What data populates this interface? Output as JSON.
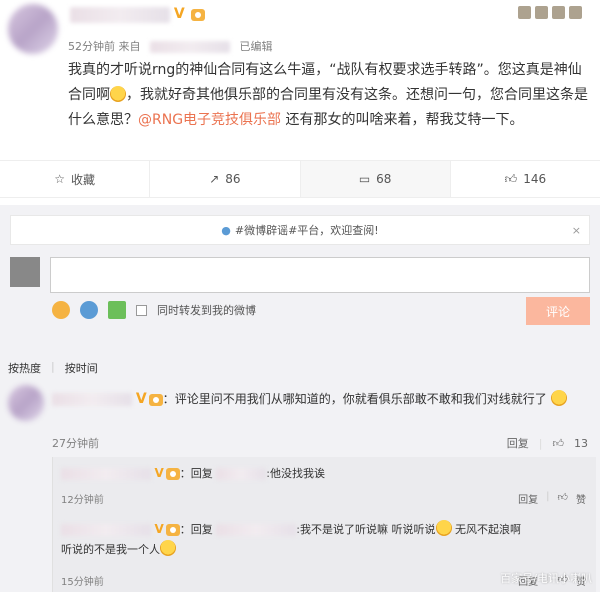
{
  "post": {
    "time": "52分钟前 来自",
    "edited": "已编辑",
    "text_part1": "我真的才听说rng的神仙合同有这么牛逼，“战队有权要求选手转路”。您这真是神仙合同啊",
    "text_part2": "，我就好奇其他俱乐部的合同里有没有这条。还想问一句，您合同里这条是什么意思？",
    "mention": "@RNG电子竞技俱乐部",
    "text_part3": " 还有那女的叫啥来着，帮我艾特一下。"
  },
  "actions": {
    "favorite": "收藏",
    "repost": "86",
    "comment": "68",
    "like": "146"
  },
  "notice": {
    "text": "#微博辟谣#平台，欢迎查阅!",
    "close": "×"
  },
  "composer": {
    "placeholder": "",
    "forward_label": "同时转发到我的微博",
    "submit": "评论"
  },
  "sort": {
    "hot": "按热度",
    "time": "按时间"
  },
  "comment1": {
    "text": "评论里问不用我们从哪知道的，你就看俱乐部敢不敢和我们对线就行了",
    "time": "27分钟前",
    "reply": "回复",
    "likes": "13"
  },
  "reply1": {
    "prefix": "回复",
    "text": ":他没找我诶",
    "time": "12分钟前",
    "reply": "回复",
    "like": "赞"
  },
  "reply2": {
    "prefix": "回复",
    "text1": ":我不是说了听说嘛 听说听说",
    "text2": " 无风不起浪啊",
    "text3": "听说的不是我一个人",
    "time": "15分钟前",
    "reply": "回复",
    "like": "赞"
  },
  "watermark": "百家号/电讯小喇叭"
}
